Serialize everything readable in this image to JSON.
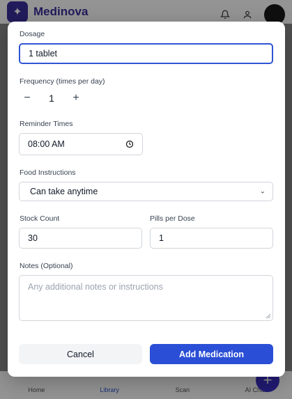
{
  "app": {
    "brand": "Medinova"
  },
  "nav": {
    "items": [
      "Home",
      "Library",
      "Scan",
      "AI Chat"
    ],
    "active": "Library"
  },
  "form": {
    "dosage_label": "Dosage",
    "dosage_value": "1 tablet",
    "frequency_label": "Frequency (times per day)",
    "frequency_value": "1",
    "minus": "−",
    "plus": "+",
    "reminder_label": "Reminder Times",
    "reminder_value": "08:00 AM",
    "food_label": "Food Instructions",
    "food_value": "Can take anytime",
    "stock_label": "Stock Count",
    "stock_value": "30",
    "pills_label": "Pills per Dose",
    "pills_value": "1",
    "notes_label": "Notes (Optional)",
    "notes_placeholder": "Any additional notes or instructions"
  },
  "actions": {
    "cancel": "Cancel",
    "add": "Add Medication"
  },
  "colors": {
    "primary": "#2a4fd6",
    "brand": "#3b2f9e"
  }
}
